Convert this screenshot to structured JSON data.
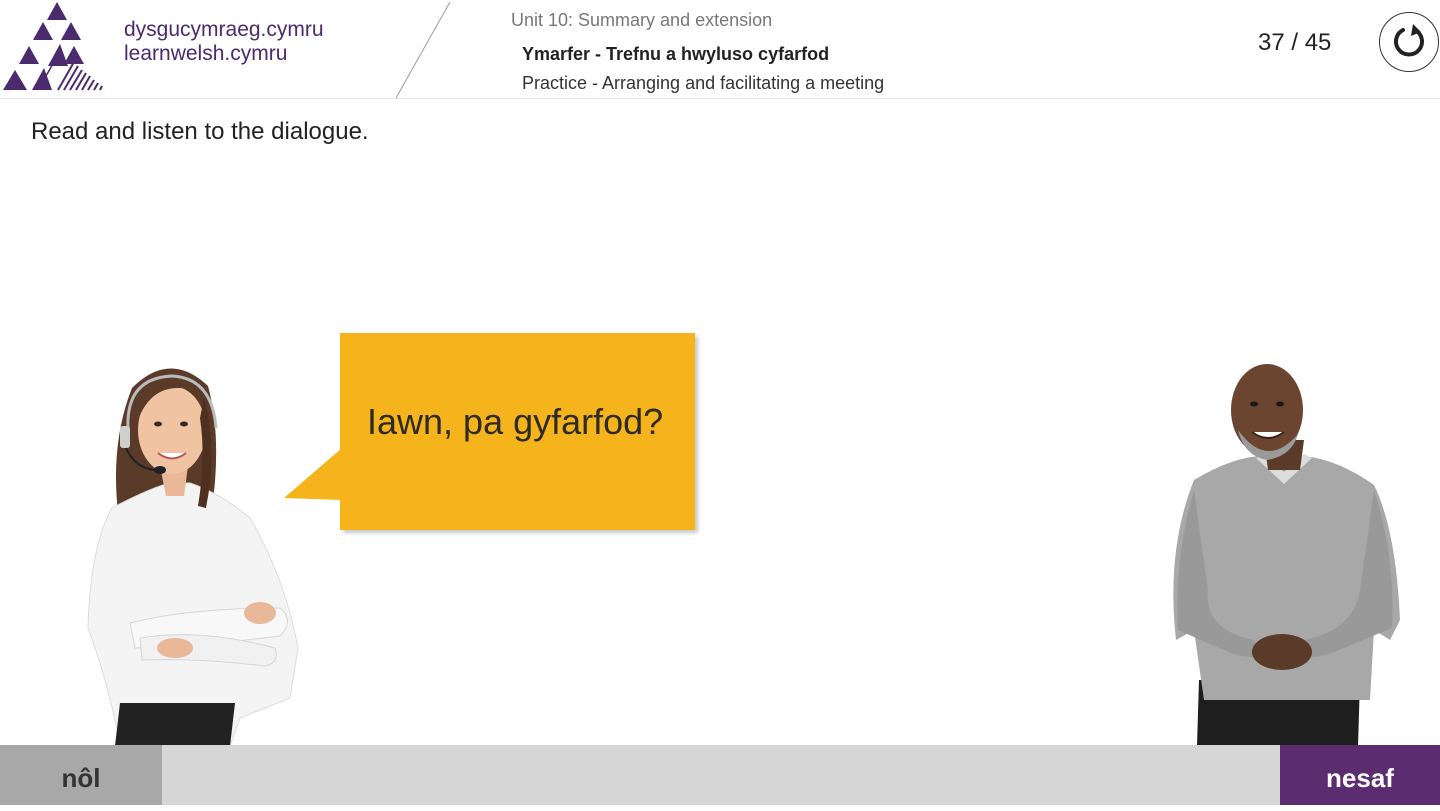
{
  "brand": {
    "line1": "dysgucymraeg.cymru",
    "line2": "learnwelsh.cymru",
    "color": "#4b2a6e"
  },
  "header": {
    "unit": "Unit 10: Summary and extension",
    "title_cy": "Ymarfer - Trefnu a hwyluso cyfarfod",
    "title_en": "Practice - Arranging and facilitating a meeting",
    "page_counter": "37 / 45",
    "reload_icon": "reload-icon"
  },
  "instruction": "Read and listen to the dialogue.",
  "dialogue": {
    "bubble_text": "Iawn, pa gyfarfod?",
    "bubble_color": "#f5b41b"
  },
  "nav": {
    "prev_label": "nôl",
    "next_label": "nesaf",
    "next_color": "#5b2c6f"
  }
}
